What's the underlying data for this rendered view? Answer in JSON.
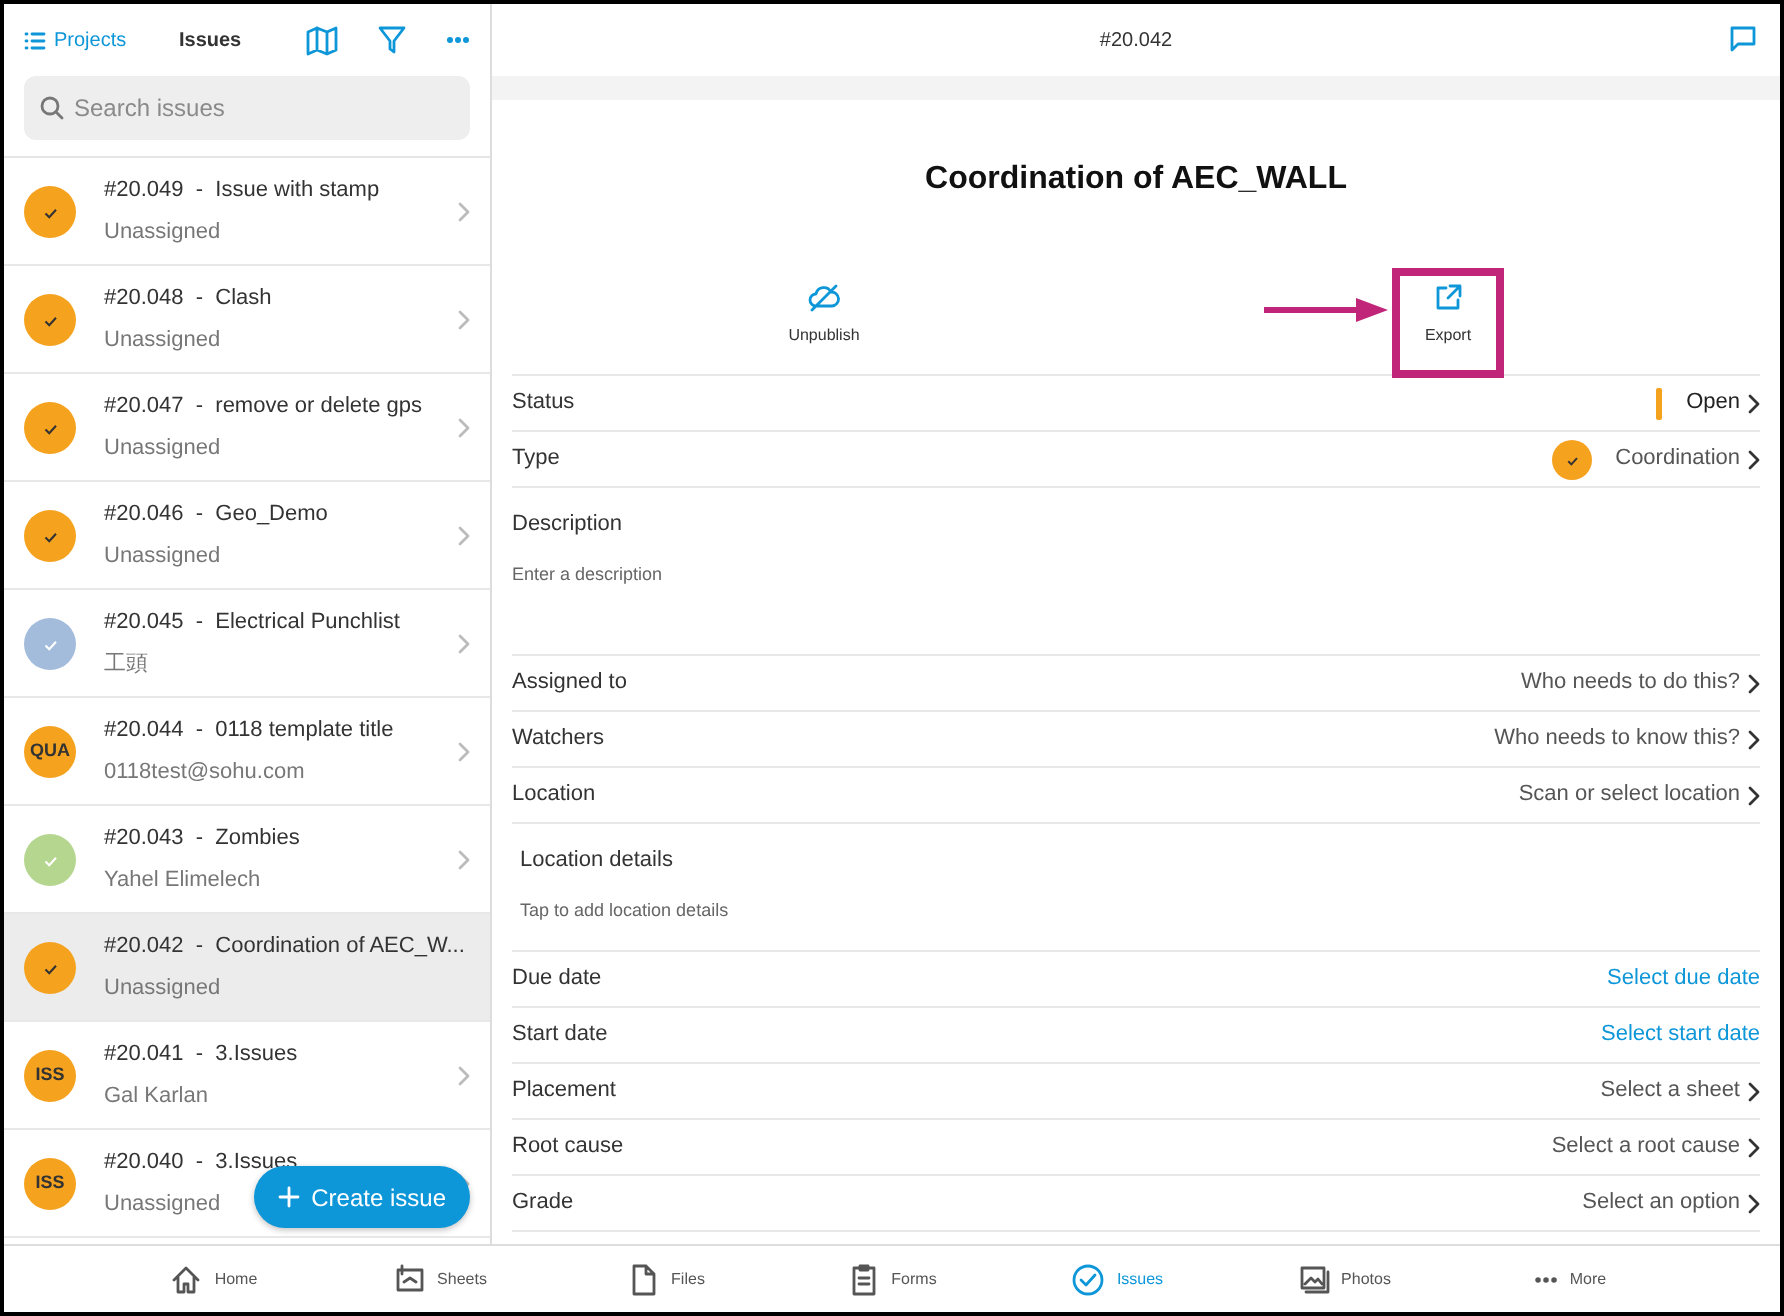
{
  "sidebar": {
    "back_link": "Projects",
    "title": "Issues",
    "search": {
      "placeholder": "Search issues"
    },
    "issues": [
      {
        "title": "#20.049  -  Issue with stamp",
        "assignee": "Unassigned",
        "kind": "check",
        "color": "#f5a21f",
        "selected": false
      },
      {
        "title": "#20.048  -  Clash",
        "assignee": "Unassigned",
        "kind": "check",
        "color": "#f5a21f",
        "selected": false
      },
      {
        "title": "#20.047  -  remove or delete gps",
        "assignee": "Unassigned",
        "kind": "check",
        "color": "#f5a21f",
        "selected": false
      },
      {
        "title": "#20.046  -  Geo_Demo",
        "assignee": "Unassigned",
        "kind": "check",
        "color": "#f5a21f",
        "selected": false
      },
      {
        "title": "#20.045  -  Electrical Punchlist",
        "assignee": "工頭",
        "kind": "check",
        "color": "#a3bcdc",
        "selected": false
      },
      {
        "title": "#20.044  -  0118 template title",
        "assignee": "0118test@sohu.com",
        "kind": "text",
        "badge": "QUA",
        "color": "#f5a21f",
        "selected": false
      },
      {
        "title": "#20.043  -  Zombies",
        "assignee": "Yahel Elimelech",
        "kind": "check",
        "color": "#b5d68f",
        "selected": false
      },
      {
        "title": "#20.042  -  Coordination of AEC_W...",
        "assignee": "Unassigned",
        "kind": "check",
        "color": "#f5a21f",
        "selected": true
      },
      {
        "title": "#20.041  -  3.Issues",
        "assignee": "Gal Karlan",
        "kind": "text",
        "badge": "ISS",
        "color": "#f5a21f",
        "selected": false
      },
      {
        "title": "#20.040  -  3.Issues",
        "assignee": "Unassigned",
        "kind": "text",
        "badge": "ISS",
        "color": "#f5a21f",
        "selected": false
      }
    ],
    "create_button": "Create issue"
  },
  "detail": {
    "header": "#20.042",
    "title": "Coordination of AEC_WALL",
    "actions": [
      {
        "label": "Unpublish",
        "kind": "unpublish",
        "highlighted": false
      },
      {
        "label": "Export",
        "kind": "export",
        "highlighted": true
      }
    ],
    "fields": [
      {
        "kind": "status",
        "label": "Status",
        "value": "Open"
      },
      {
        "kind": "type",
        "label": "Type",
        "value": "Coordination"
      },
      {
        "kind": "text",
        "label": "Description",
        "placeholder": "Enter a description"
      },
      {
        "kind": "select",
        "label": "Assigned to",
        "value": "Who needs to do this?"
      },
      {
        "kind": "select",
        "label": "Watchers",
        "value": "Who needs to know this?"
      },
      {
        "kind": "select",
        "label": "Location",
        "value": "Scan or select location"
      },
      {
        "kind": "text",
        "label": "Location details",
        "placeholder": "Tap to add location details"
      },
      {
        "kind": "link",
        "label": "Due date",
        "value": "Select due date"
      },
      {
        "kind": "link",
        "label": "Start date",
        "value": "Select start date"
      },
      {
        "kind": "select",
        "label": "Placement",
        "value": "Select a sheet"
      },
      {
        "kind": "select",
        "label": "Root cause",
        "value": "Select a root cause"
      },
      {
        "kind": "select",
        "label": "Grade",
        "value": "Select an option"
      }
    ]
  },
  "tab_bar": [
    {
      "label": "Home",
      "kind": "home",
      "selected": false
    },
    {
      "label": "Sheets",
      "kind": "sheets",
      "selected": false
    },
    {
      "label": "Files",
      "kind": "files",
      "selected": false
    },
    {
      "label": "Forms",
      "kind": "forms",
      "selected": false
    },
    {
      "label": "Issues",
      "kind": "issues",
      "selected": true
    },
    {
      "label": "Photos",
      "kind": "photos",
      "selected": false
    },
    {
      "label": "More",
      "kind": "more",
      "selected": false
    }
  ]
}
